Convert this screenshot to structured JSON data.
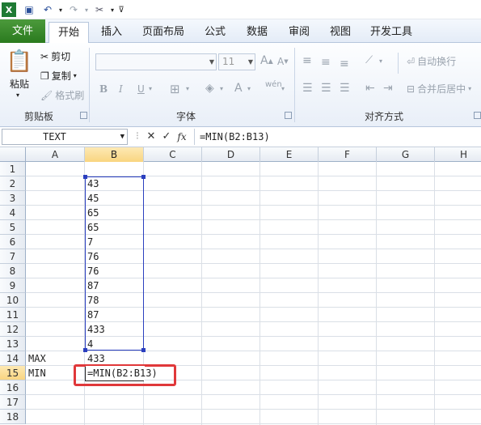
{
  "qat": {
    "app_icon": "excel-icon",
    "save_icon": "save-icon",
    "undo_icon": "undo-icon",
    "redo_icon": "redo-icon",
    "tools_icon": "tools-icon",
    "customize_icon": "customize-icon"
  },
  "tabs": [
    "文件",
    "开始",
    "插入",
    "页面布局",
    "公式",
    "数据",
    "审阅",
    "视图",
    "开发工具"
  ],
  "ribbon": {
    "clipboard": {
      "paste": "粘贴",
      "cut": "剪切",
      "copy": "复制",
      "format_painter": "格式刷",
      "label": "剪贴板"
    },
    "font": {
      "font_name": "",
      "font_size": "11",
      "label": "字体"
    },
    "alignment": {
      "wrap_text": "自动换行",
      "merge_center": "合并后居中",
      "label": "对齐方式"
    }
  },
  "formula_bar": {
    "name_box": "TEXT",
    "fx": "fx",
    "formula": "=MIN(B2:B13)"
  },
  "columns": [
    "A",
    "B",
    "C",
    "D",
    "E",
    "F",
    "G",
    "H"
  ],
  "active_column": "B",
  "rows": [
    "1",
    "2",
    "3",
    "4",
    "5",
    "6",
    "7",
    "8",
    "9",
    "10",
    "11",
    "12",
    "13",
    "14",
    "15",
    "16",
    "17",
    "18"
  ],
  "active_row": "15",
  "cells": {
    "B2": "43",
    "B3": "45",
    "B4": "65",
    "B5": "65",
    "B6": "7",
    "B7": "76",
    "B8": "76",
    "B9": "87",
    "B10": "78",
    "B11": "87",
    "B12": "433",
    "B13": "4",
    "A14": "MAX",
    "B14": "433",
    "A15": "MIN",
    "B15": "=MIN(B2:B13)"
  },
  "colors": {
    "file_tab": "#2a7a1e",
    "selection_border": "#2b3fbf",
    "highlight_box": "#e0383a",
    "active_header": "#f9d580"
  }
}
